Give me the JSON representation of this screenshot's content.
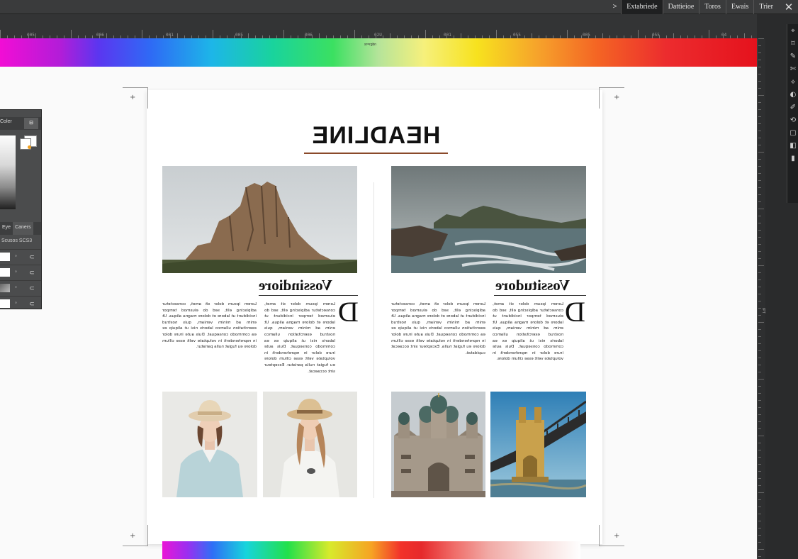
{
  "menubar": {
    "items": [
      {
        "label": "Trier",
        "active": false
      },
      {
        "label": "Ewais",
        "active": false
      },
      {
        "label": "Toros",
        "active": false
      },
      {
        "label": "Dattieioe",
        "active": false
      },
      {
        "label": "Extabriede",
        "active": true
      }
    ],
    "arrow": ">",
    "close": "✕"
  },
  "ruler": {
    "labels": [
      "005",
      "006",
      "001",
      "005",
      "006",
      "02U",
      "001",
      "055",
      "005",
      "055",
      "04"
    ],
    "vertical_center_label": "IPT"
  },
  "toolbar": {
    "tools": [
      "⌖",
      "⌑",
      "✎",
      "✄",
      "⟡",
      "◐",
      "✐",
      "⟲",
      "▢",
      "◧",
      "▮"
    ]
  },
  "canvas": {
    "rainbow_label": "sr=rgbn"
  },
  "left_panel": {
    "tab_top": "Coler",
    "tab_icon": "⊟",
    "tabs": [
      {
        "label": "Eye",
        "active": false
      },
      {
        "label": "Caners",
        "active": true
      }
    ],
    "sub_label": "Scusos SCS3",
    "layers": [
      {
        "thumb": "white",
        "eye": "◦",
        "link": "⊂"
      },
      {
        "thumb": "white",
        "eye": "◦",
        "link": "⊂"
      },
      {
        "thumb": "photo",
        "eye": "◦",
        "link": "⊂"
      },
      {
        "thumb": "white",
        "eye": "◦",
        "link": "⊂"
      }
    ]
  },
  "page": {
    "headline": "HEADLINE",
    "left_article": {
      "title": "Vossindiore",
      "dropcap": "D",
      "body_left": "Lorem ipsum dolor sit amet, consectetur adipiscing elit, sed do eiusmod tempor incididunt ut labore et dolore magna aliqua. Ut enim ad minim veniam, quis nostrud exercitation ullamco laboris nisi ut aliquip ex ea commodo consequat. Duis aute irure dolor in reprehenderit in voluptate velit esse cillum dolore eu fugiat nulla pariatur.",
      "body_right": "Lorem ipsum dolor sit amet, consectetur adipiscing elit, sed do eiusmod tempor incididunt ut labore et dolore magna aliqua. Ut enim ad minim veniam, quis nostrud exercitation ullamco laboris nisi ut aliquip ex ea commodo consequat. Duis aute irure dolor in reprehenderit in voluptate velit esse cillum dolore eu fugiat nulla pariatur. Excepteur sint occaecat."
    },
    "right_article": {
      "title": "Vossitudore",
      "dropcap": "D",
      "body_left": "Lorem ipsum dolor sit amet, consectetur adipiscing elit, sed do eiusmod tempor incididunt ut labore et dolore magna aliqua. Ut enim ad minim veniam, quis nostrud exercitation ullamco laboris nisi ut aliquip ex ea commodo consequat. Duis aute irure dolor in reprehenderit in voluptate velit esse cillum dolore eu fugiat nulla. Excepteur sint occaecat cupidatat.",
      "body_right": "Lorem ipsum dolor sit amet, consectetur adipiscing elit, sed do eiusmod tempor incididunt ut labore et dolore magna aliqua. Ut enim ad minim veniam, quis nostrud exercitation ullamco laboris nisi ut aliquip ex ea commodo consequat. Duis aute irure dolor in reprehenderit in voluptate velit esse cillum dolore."
    },
    "crop_symbol": "+"
  }
}
